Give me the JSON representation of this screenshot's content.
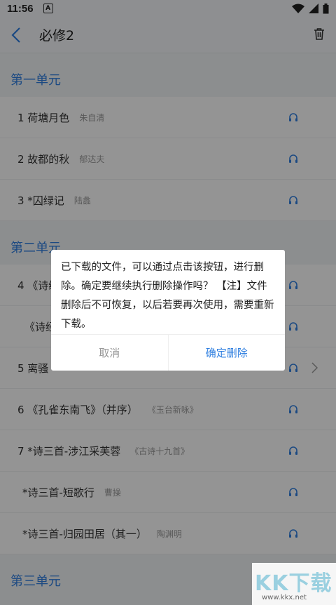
{
  "status": {
    "time": "11:56",
    "badge": "A"
  },
  "appbar": {
    "title": "必修2"
  },
  "units": [
    {
      "title": "第一单元",
      "lessons": [
        {
          "name": "1 荷塘月色",
          "author": "朱自清"
        },
        {
          "name": "2 故都的秋",
          "author": "郁达夫"
        },
        {
          "name": "3 *囚绿记",
          "author": "陆蠡"
        }
      ]
    },
    {
      "title": "第二单元",
      "lessons": [
        {
          "name": "4 《诗经》两首",
          "author": ""
        },
        {
          "name": "《诗经》",
          "author": ""
        },
        {
          "name": "5 离骚",
          "author": ""
        },
        {
          "name": "6 《孔雀东南飞》（并序）",
          "author": "《玉台新咏》"
        },
        {
          "name": "7 *诗三首-涉江采芙蓉",
          "author": "《古诗十九首》"
        },
        {
          "name": "*诗三首-短歌行",
          "author": "曹操"
        },
        {
          "name": "*诗三首-归园田居（其一）",
          "author": "陶渊明"
        }
      ]
    },
    {
      "title": "第三单元",
      "lessons": []
    }
  ],
  "dialog": {
    "message": "已下载的文件，可以通过点击该按钮，进行删除。确定要继续执行删除操作吗？ 【注】文件删除后不可恢复，以后若要再次使用，需要重新下载。",
    "cancel_label": "取消",
    "confirm_label": "确定删除"
  },
  "watermark": {
    "logo": "KK下载",
    "url": "www.kkx.net"
  },
  "colors": {
    "accent": "#2f7fe0",
    "background": "#f2f4f7"
  }
}
